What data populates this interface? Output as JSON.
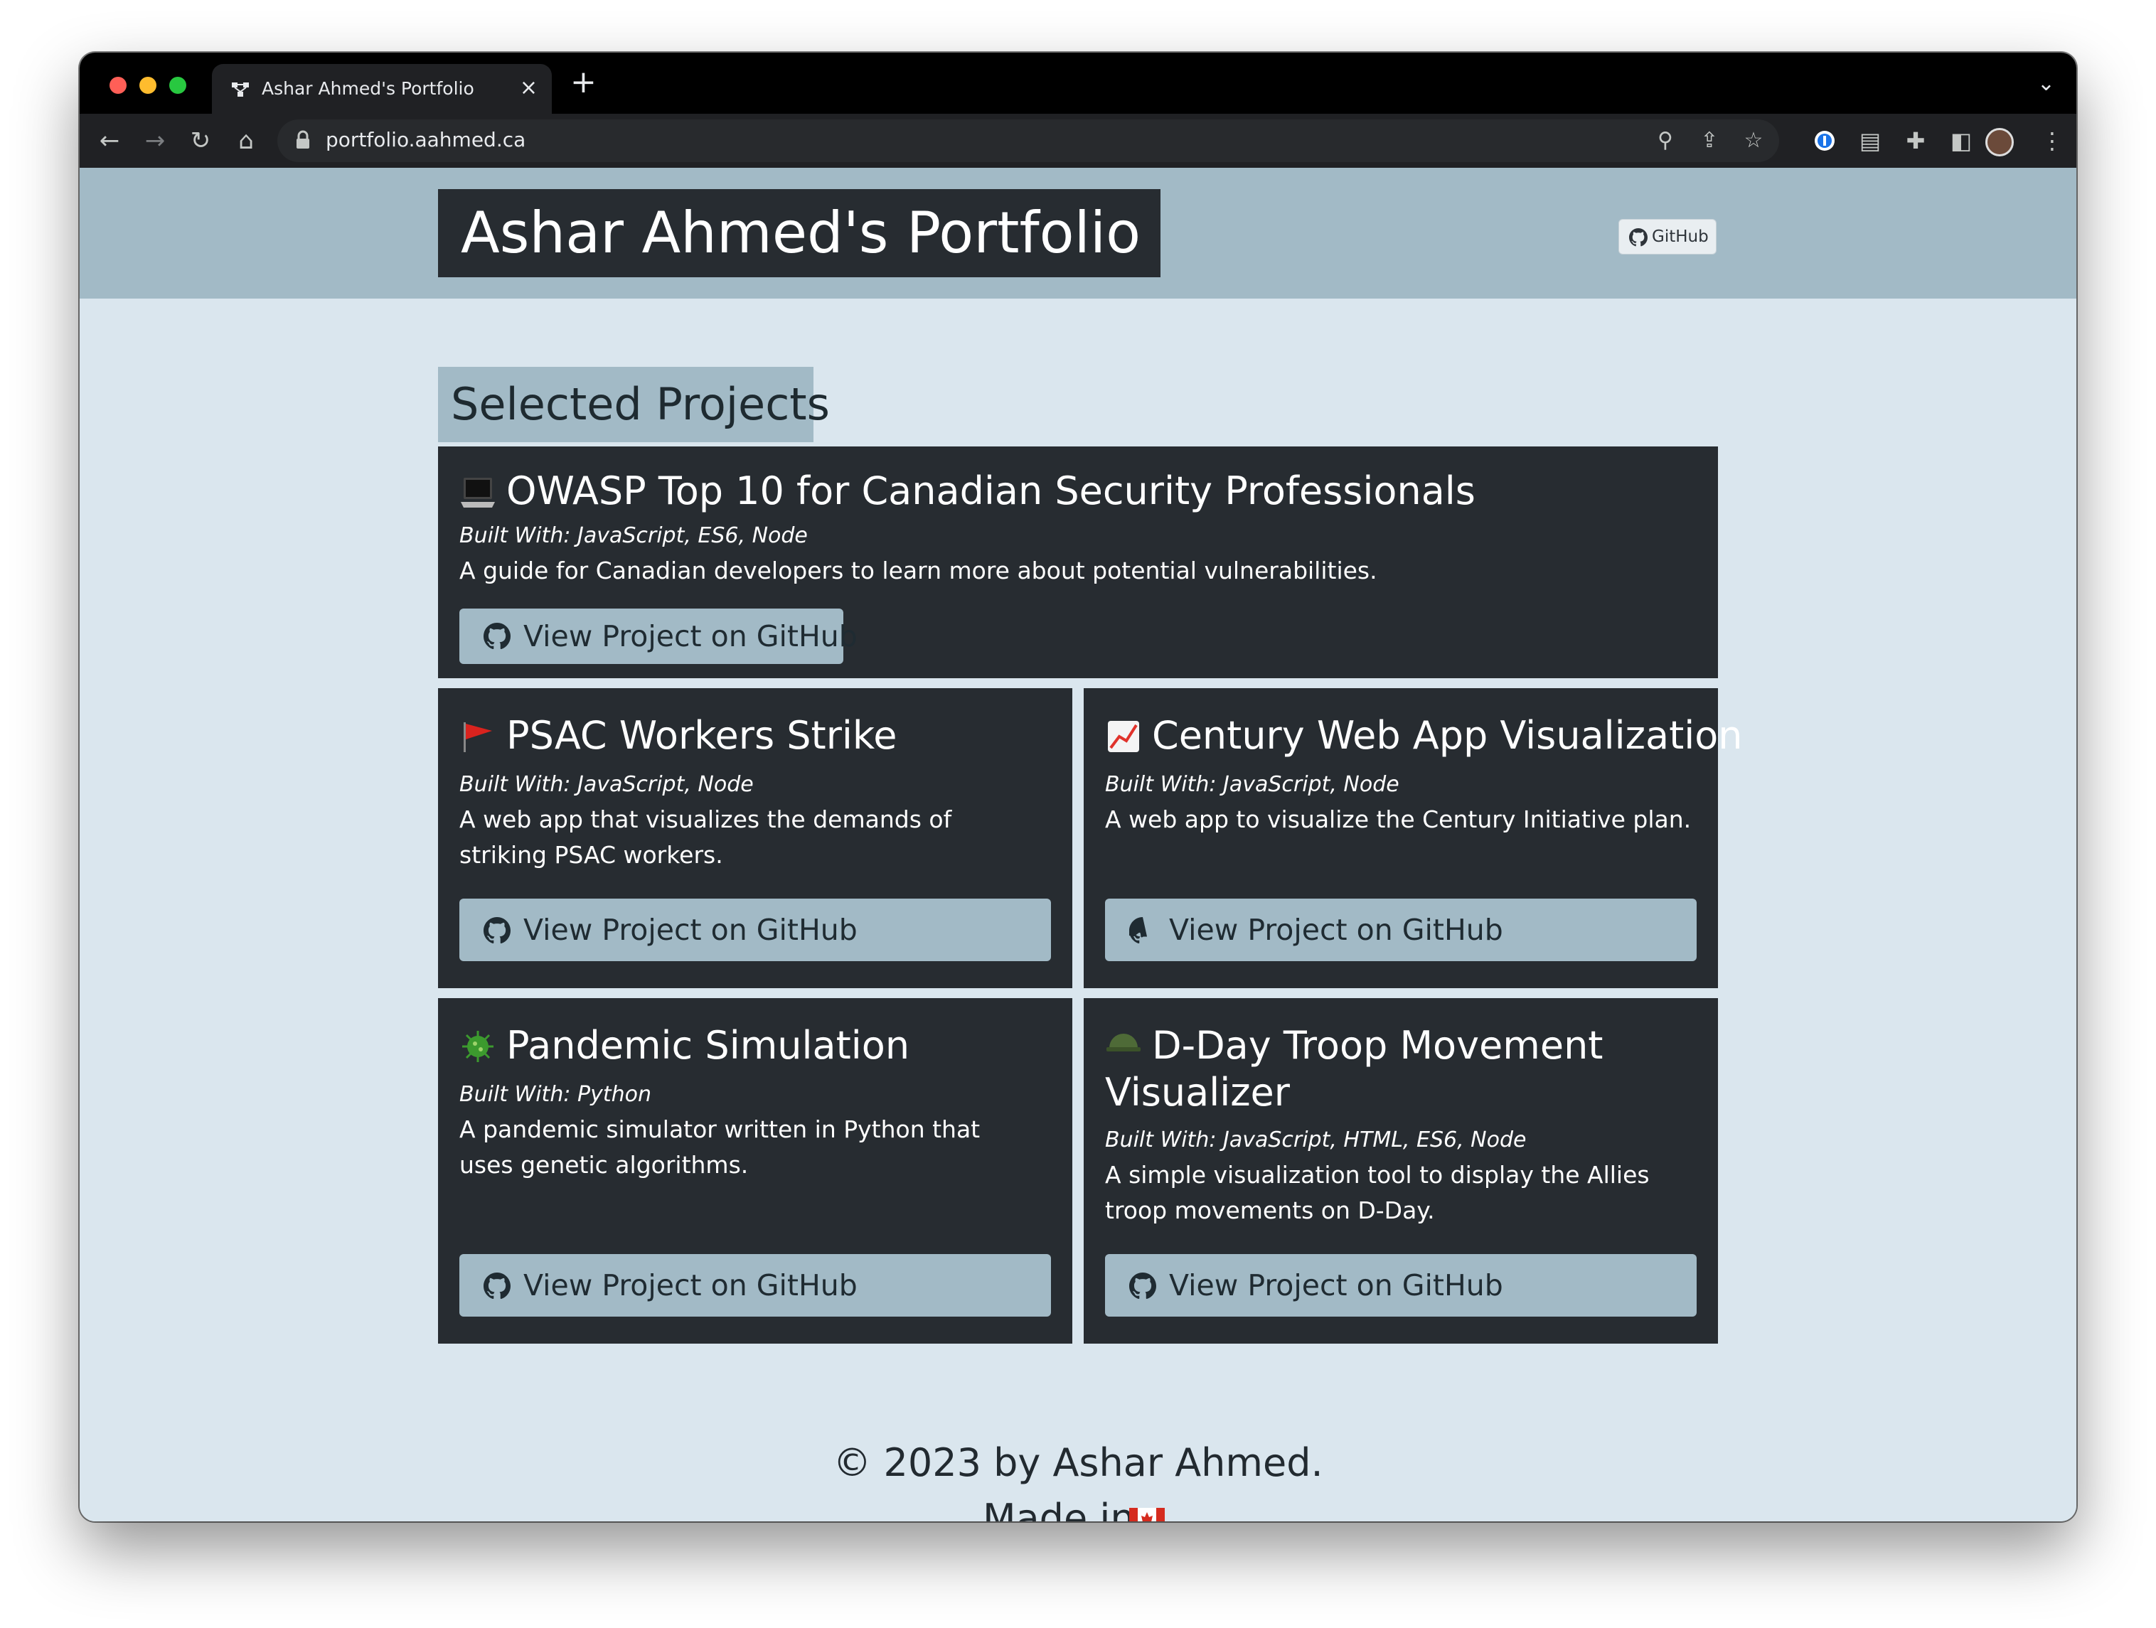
{
  "browser": {
    "tab_title": "Ashar Ahmed's Portfolio",
    "tab_close": "×",
    "new_tab": "+",
    "url": "portfolio.aahmed.ca"
  },
  "header": {
    "site_title": "Ashar Ahmed's Portfolio",
    "github_link": "GitHub"
  },
  "main": {
    "section_title": "Selected Projects",
    "projects": [
      {
        "emoji": "laptop-icon",
        "title": "OWASP Top 10 for Canadian Security Professionals",
        "built_with": "Built With: JavaScript, ES6, Node",
        "description": "A guide for Canadian developers to learn more about potential vulnerabilities.",
        "button": "View Project on GitHub"
      },
      {
        "emoji": "red-flag-icon",
        "title": "PSAC Workers Strike",
        "built_with": "Built With: JavaScript, Node",
        "description": "A web app that visualizes the demands of striking PSAC workers.",
        "button": "View Project on GitHub"
      },
      {
        "emoji": "chart-increasing-icon",
        "title": "Century Web App Visualization",
        "built_with": "Built With: JavaScript, Node",
        "description": "A web app to visualize the Century Initiative plan.",
        "button": "View Project on GitHub"
      },
      {
        "emoji": "microbe-icon",
        "title": "Pandemic Simulation",
        "built_with": "Built With: Python",
        "description": "A pandemic simulator written in Python that uses genetic algorithms.",
        "button": "View Project on GitHub"
      },
      {
        "emoji": "military-helmet-icon",
        "title": "D-Day Troop Movement Visualizer",
        "built_with": "Built With: JavaScript, HTML, ES6, Node",
        "description": "A simple visualization tool to display the Allies troop movements on D-Day.",
        "button": "View Project on GitHub"
      }
    ]
  },
  "footer": {
    "copyright": "© 2023 by Ashar Ahmed.",
    "made_in": "Made in"
  },
  "colors": {
    "header_band": "#a2bac6",
    "page_bg": "#dae6ee",
    "card_bg": "#272c31",
    "button_bg": "#a2bac6"
  }
}
